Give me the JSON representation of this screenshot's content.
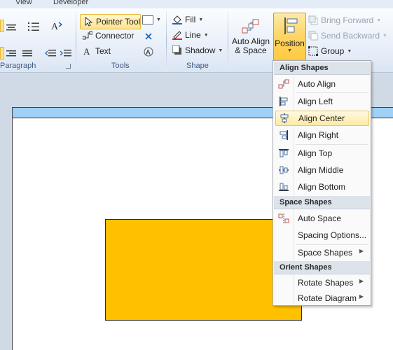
{
  "tabs": [
    "View",
    "Developer"
  ],
  "ribbon": {
    "groups": {
      "paragraph": "Paragraph",
      "tools": "Tools",
      "shape": "Shape"
    },
    "tools": {
      "pointer_tool": "Pointer Tool",
      "connector": "Connector",
      "text": "Text"
    },
    "shape": {
      "fill": "Fill",
      "line": "Line",
      "shadow": "Shadow"
    },
    "arrange": {
      "auto_align_line1": "Auto Align",
      "auto_align_line2": "& Space",
      "position": "Position",
      "bring_forward": "Bring Forward",
      "send_backward": "Send Backward",
      "group": "Group"
    }
  },
  "menu": {
    "align_header": "Align Shapes",
    "align_items": [
      "Auto Align",
      "Align Left",
      "Align Center",
      "Align Right",
      "Align Top",
      "Align Middle",
      "Align Bottom"
    ],
    "space_header": "Space Shapes",
    "space_items": [
      "Auto Space",
      "Spacing Options...",
      "Space Shapes"
    ],
    "orient_header": "Orient Shapes",
    "orient_items": [
      "Rotate Shapes",
      "Rotate Diagram"
    ],
    "highlighted": "Align Center"
  },
  "colors": {
    "shape_fill": "#ffc000",
    "page_header": "#9fd1f7",
    "highlight": "#ffe9a3"
  }
}
